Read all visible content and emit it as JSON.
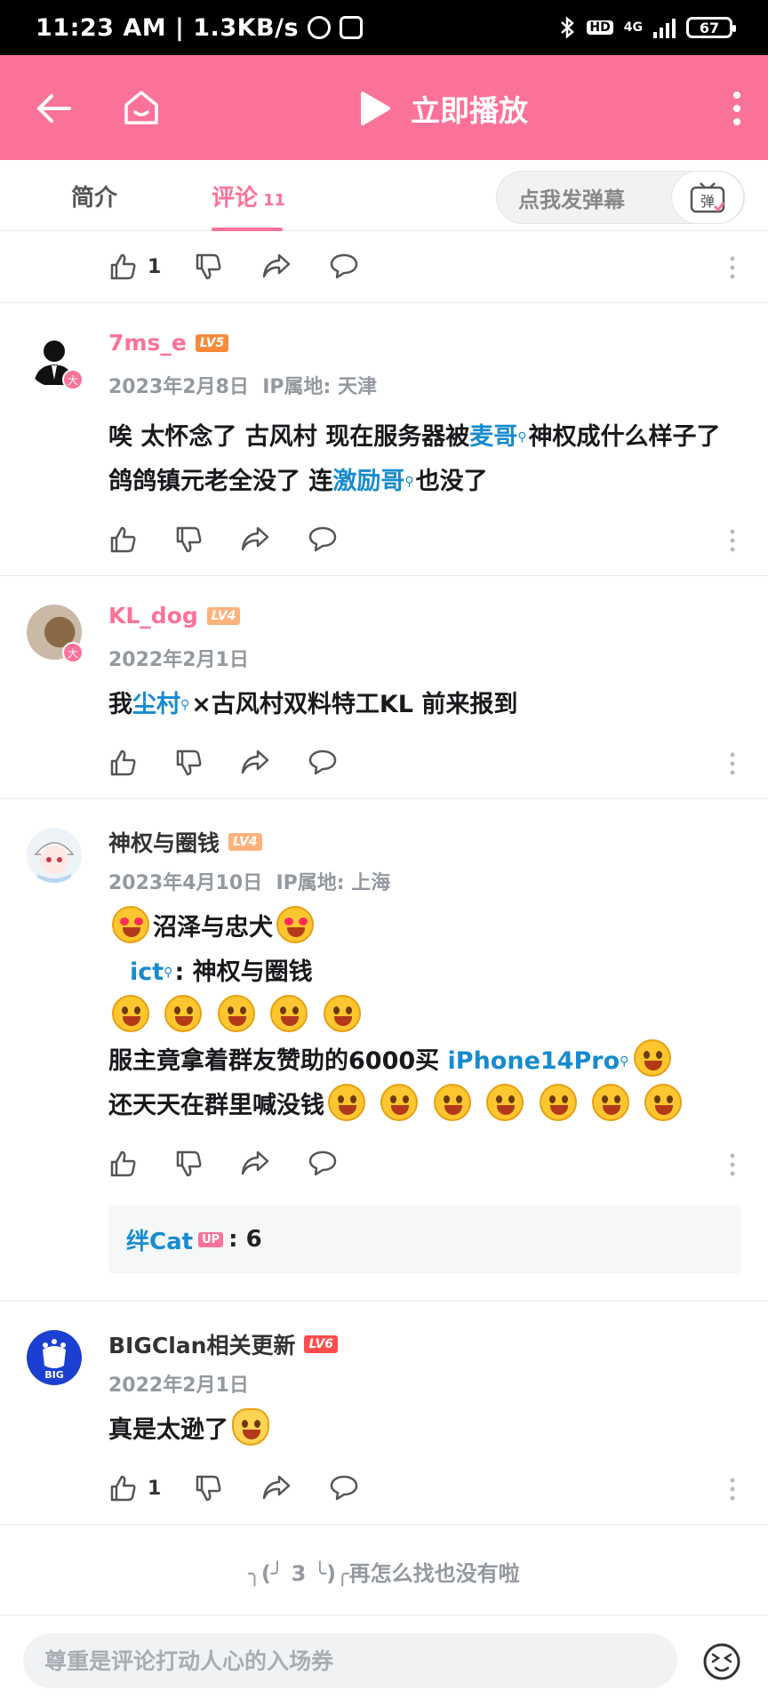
{
  "status_bar": {
    "time": "11:23 AM | 1.3KB/s",
    "network": "4G",
    "hd": "HD",
    "battery": "67"
  },
  "app_bar": {
    "play_label": "立即播放"
  },
  "tabs": {
    "intro": "简介",
    "comments": "评论",
    "comment_count": "11",
    "danmaku_placeholder": "点我发弹幕",
    "danmaku_button": "弹"
  },
  "top_actions": {
    "like_count": "1"
  },
  "comments": [
    {
      "user": "7ms_e",
      "level": "LV5",
      "date": "2023年2月8日",
      "ip": "IP属地: 天津",
      "text_a": "唉 太怀念了 古风村 现在服务器被",
      "link_a": "麦哥",
      "text_b": "神权成什么样子了 鸽鸽镇元老全没了 连",
      "link_b": "激励哥",
      "text_c": "也没了"
    },
    {
      "user": "KL_dog",
      "level": "LV4",
      "date": "2022年2月1日",
      "text_a": "我",
      "link_a": "尘村",
      "text_b": "×古风村双料特工KL 前来报到"
    },
    {
      "user": "神权与圈钱",
      "level": "LV4",
      "date": "2023年4月10日",
      "ip": "IP属地: 上海",
      "line1": "沼泽与忠犬",
      "line2_link": "ict",
      "line2_text": ": 神权与圈钱",
      "line4_a": "服主竟拿着群友赞助的6000买 ",
      "line4_link": "iPhone14Pro",
      "line5": "还天天在群里喊没钱",
      "reply_name": "绊Cat",
      "reply_tag": "UP",
      "reply_text": ": 6"
    },
    {
      "user": "BIGClan相关更新",
      "level": "LV6",
      "date": "2022年2月1日",
      "text": "真是太逊了",
      "like_count": "1",
      "avatar_text": "BIG"
    }
  ],
  "end_text": "╮(╯ 3 ╰)╭再怎么找也没有啦",
  "input": {
    "placeholder": "尊重是评论打动人心的入场券"
  }
}
